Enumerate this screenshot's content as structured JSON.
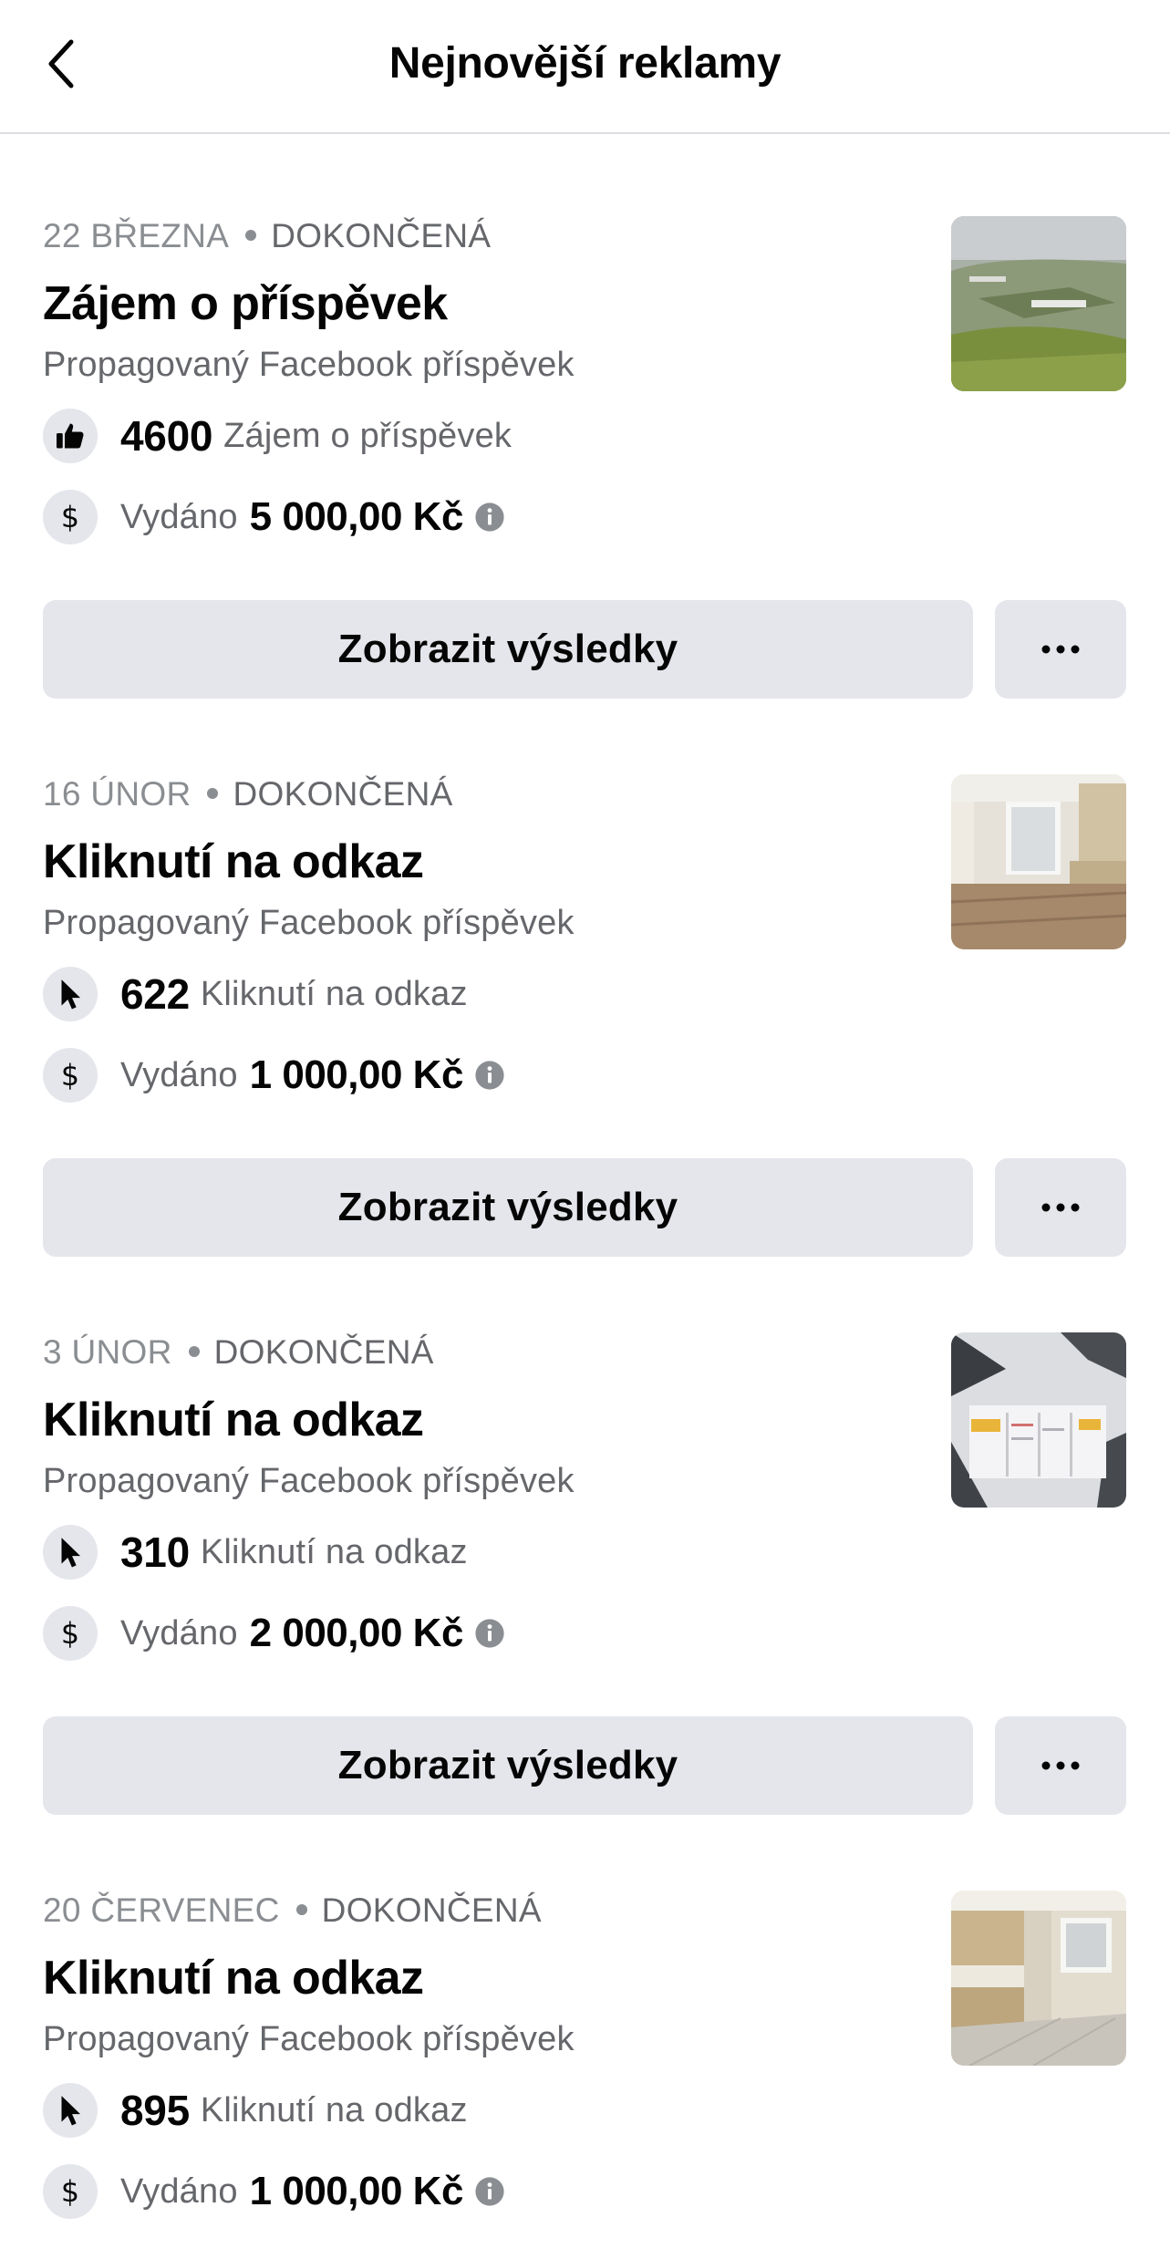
{
  "header": {
    "title": "Nejnovější reklamy",
    "back_icon": "chevron-left-icon"
  },
  "ads": [
    {
      "date": "22 BŘEZNA",
      "status": "DOKONČENÁ",
      "title": "Zájem o příspěvek",
      "subtitle": "Propagovaný Facebook příspěvek",
      "metric_icon": "thumbs-up-icon",
      "metric_value": "4600",
      "metric_label": "Zájem o příspěvek",
      "spent_label": "Vydáno",
      "spent_amount": "5 000,00 Kč",
      "thumbnail": "aerial-green-roof-building-photo",
      "results_label": "Zobrazit výsledky",
      "more_icon": "more-dots-icon"
    },
    {
      "date": "16 ÚNOR",
      "status": "DOKONČENÁ",
      "title": "Kliknutí na odkaz",
      "subtitle": "Propagovaný Facebook příspěvek",
      "metric_icon": "cursor-icon",
      "metric_value": "622",
      "metric_label": "Kliknutí na odkaz",
      "spent_label": "Vydáno",
      "spent_amount": "1 000,00 Kč",
      "thumbnail": "apartment-interior-photo",
      "results_label": "Zobrazit výsledky",
      "more_icon": "more-dots-icon"
    },
    {
      "date": "3 ÚNOR",
      "status": "DOKONČENÁ",
      "title": "Kliknutí na odkaz",
      "subtitle": "Propagovaný Facebook příspěvek",
      "metric_icon": "cursor-icon",
      "metric_value": "310",
      "metric_label": "Kliknutí na odkaz",
      "spent_label": "Vydáno",
      "spent_amount": "2 000,00 Kč",
      "thumbnail": "floor-plan-graphic",
      "results_label": "Zobrazit výsledky",
      "more_icon": "more-dots-icon"
    },
    {
      "date": "20 ČERVENEC",
      "status": "DOKONČENÁ",
      "title": "Kliknutí na odkaz",
      "subtitle": "Propagovaný Facebook příspěvek",
      "metric_icon": "cursor-icon",
      "metric_value": "895",
      "metric_label": "Kliknutí na odkaz",
      "spent_label": "Vydáno",
      "spent_amount": "1 000,00 Kč",
      "thumbnail": "kitchen-interior-photo",
      "results_label": "",
      "more_icon": ""
    }
  ]
}
